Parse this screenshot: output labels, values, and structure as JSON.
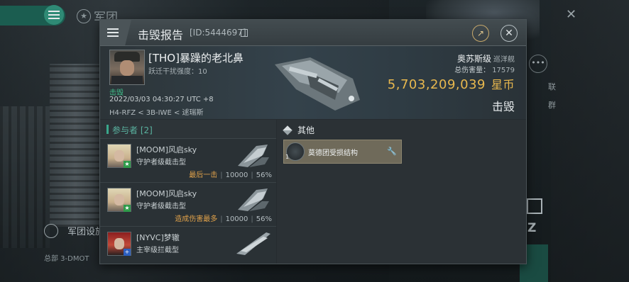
{
  "background": {
    "app_title": "军团",
    "bottom_menu_label": "军团设施",
    "bottom_hq_text": "总部 3-DMOT",
    "side_texts": [
      "联",
      "群"
    ]
  },
  "dialog": {
    "title": "击毁报告",
    "report_id": "[ID:5444697]"
  },
  "victim": {
    "name": "[THO]暴躁的老北鼻",
    "warp_scramble": "跃迁干扰强度：10",
    "status_label": "击毁",
    "time": "2022/03/03 04:30:27 UTC +8",
    "location": "H4-RFZ < 3B-IWE < 逑瑞斯",
    "ship_name": "奥苏斯级",
    "ship_type": "巡洋舰",
    "total_damage_label": "总伤害量：",
    "total_damage": "17579",
    "isk_value": "5,703,209,039",
    "isk_unit": "星币",
    "result": "击毁"
  },
  "participants": {
    "title": "参与者 [2]",
    "rows": [
      {
        "name": "[MOOM]风启sky",
        "ship": "守护者级截击型",
        "tag": "最后一击",
        "damage": "10000",
        "percent": "56%"
      },
      {
        "name": "[MOOM]风启sky",
        "ship": "守护者级截击型",
        "tag": "造成伤害最多",
        "damage": "10000",
        "percent": "56%"
      },
      {
        "name": "[NYVC]梦辙",
        "ship": "主宰级拦截型",
        "tag": "",
        "damage": "",
        "percent": ""
      }
    ]
  },
  "other": {
    "title": "其他",
    "items": [
      {
        "label": "莫德团受损结构",
        "qty": "1"
      }
    ]
  },
  "colors": {
    "accent_teal": "#3aa88c",
    "isk_gold": "#e8b84e",
    "tag_orange": "#e1a24a"
  }
}
